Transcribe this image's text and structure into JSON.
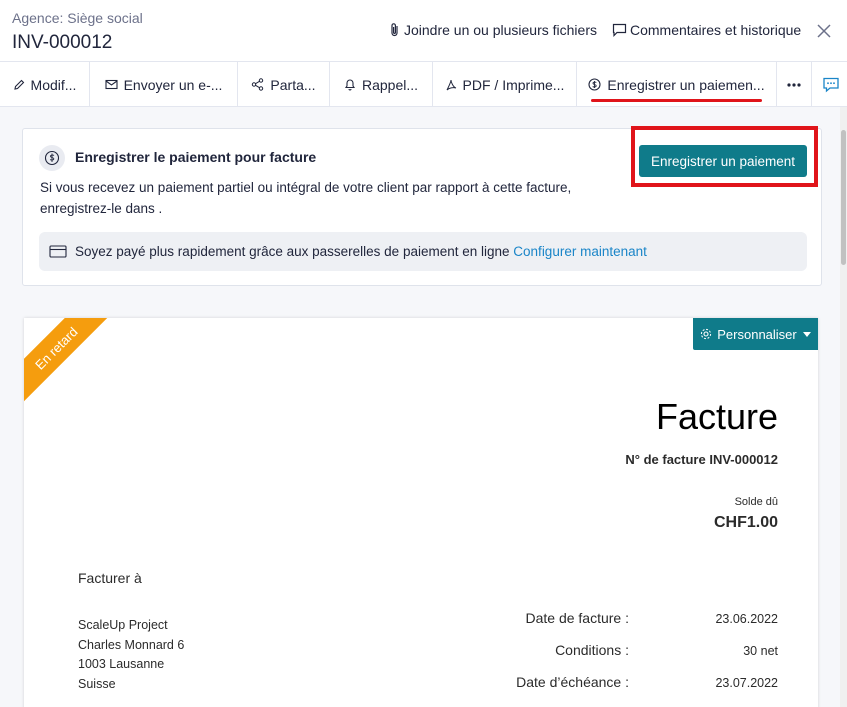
{
  "header": {
    "agency": "Agence: Siège social",
    "title": "INV-000012",
    "attach_label": "Joindre un ou plusieurs fichiers",
    "comments_label": "Commentaires et historique",
    "close_icon": "close-icon"
  },
  "toolbar": {
    "items": [
      {
        "label": "Modif...",
        "icon": "pencil-icon"
      },
      {
        "label": "Envoyer un e-...",
        "icon": "mail-icon"
      },
      {
        "label": "Parta...",
        "icon": "share-icon"
      },
      {
        "label": "Rappel...",
        "icon": "bell-icon"
      },
      {
        "label": "PDF / Imprime...",
        "icon": "pdf-icon"
      },
      {
        "label": "Enregistrer un paiemen...",
        "icon": "payment-icon"
      }
    ],
    "more_icon": "more-icon",
    "chat_icon": "chat-icon"
  },
  "payment_panel": {
    "heading": "Enregistrer le paiement pour facture",
    "text": "Si vous recevez un paiement partiel ou intégral de votre client par rapport à cette facture, enregistrez-le dans .",
    "button_label": "Enregistrer un paiement",
    "gateway_text": "Soyez payé plus rapidement grâce aux passerelles de paiement en ligne",
    "gateway_link": "Configurer maintenant"
  },
  "invoice": {
    "ribbon": "En retard",
    "customize_label": "Personnaliser",
    "title": "Facture",
    "number": "N° de facture INV-000012",
    "balance_label": "Solde dû",
    "balance_value": "CHF1.00",
    "bill_to_label": "Facturer à",
    "address": [
      "ScaleUp Project",
      "Charles Monnard 6",
      "1003 Lausanne",
      "Suisse"
    ],
    "details": [
      {
        "label": "Date de facture :",
        "value": "23.06.2022"
      },
      {
        "label": "Conditions :",
        "value": "30 net"
      },
      {
        "label": "Date d’échéance :",
        "value": "23.07.2022"
      }
    ]
  },
  "colors": {
    "accent": "#0f7b8a",
    "highlight": "#e0141a",
    "overdue": "#f59d0e",
    "link": "#1a85c8"
  }
}
